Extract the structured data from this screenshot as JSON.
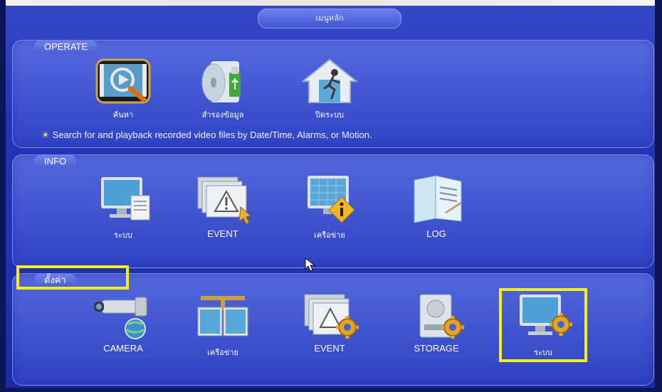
{
  "window": {
    "title": "เมนูหลัก"
  },
  "operate": {
    "tab_label": "OPERATE",
    "items": [
      {
        "label": "ค้นหา",
        "icon": "search-playback-icon"
      },
      {
        "label": "สำรองข้อมูล",
        "icon": "backup-icon"
      },
      {
        "label": "ปิดระบบ",
        "icon": "shutdown-icon"
      }
    ],
    "hint": "Search for and playback recorded video files by Date/Time, Alarms, or Motion."
  },
  "info": {
    "tab_label": "INFO",
    "items": [
      {
        "label": "ระบบ",
        "icon": "system-info-icon"
      },
      {
        "label": "EVENT",
        "icon": "event-info-icon"
      },
      {
        "label": "เครือข่าย",
        "icon": "network-info-icon"
      },
      {
        "label": "LOG",
        "icon": "log-icon"
      }
    ]
  },
  "setting": {
    "tab_label": "ตั้งค่า",
    "items": [
      {
        "label": "CAMERA",
        "icon": "camera-settings-icon"
      },
      {
        "label": "เครือข่าย",
        "icon": "network-settings-icon"
      },
      {
        "label": "EVENT",
        "icon": "event-settings-icon"
      },
      {
        "label": "STORAGE",
        "icon": "storage-settings-icon"
      },
      {
        "label": "ระบบ",
        "icon": "system-settings-icon"
      }
    ]
  },
  "colors": {
    "highlight": "#f7ef12",
    "background": "#2436b6"
  }
}
